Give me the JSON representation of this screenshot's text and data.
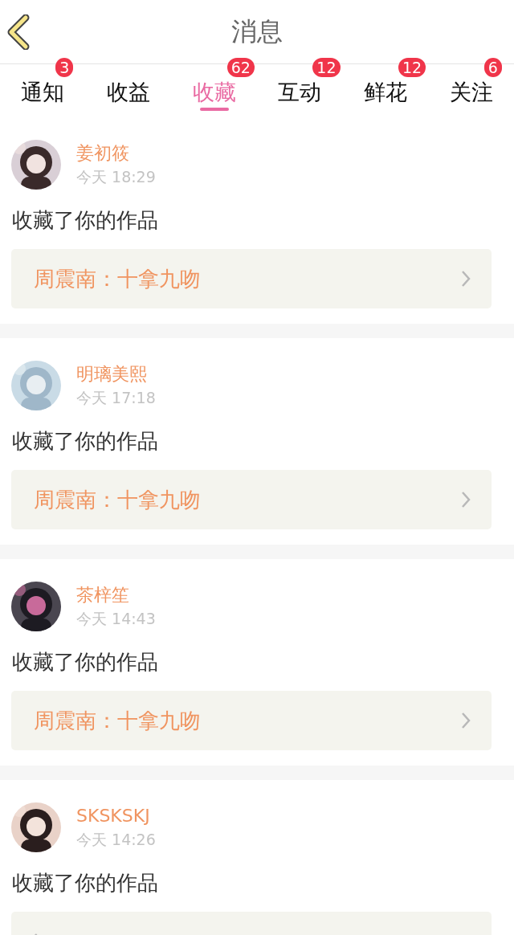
{
  "header": {
    "title": "消息"
  },
  "tabs": [
    {
      "label": "通知",
      "badge": "3",
      "selected": false
    },
    {
      "label": "收益",
      "selected": false
    },
    {
      "label": "收藏",
      "badge": "62",
      "selected": true
    },
    {
      "label": "互动",
      "badge": "12",
      "selected": false
    },
    {
      "label": "鲜花",
      "badge": "12",
      "selected": false
    },
    {
      "label": "关注",
      "badge": "6",
      "selected": false
    }
  ],
  "messages": [
    {
      "user": "姜初筱",
      "time": "今天 18:29",
      "action": "收藏了你的作品",
      "work": "周震南：十拿九吻"
    },
    {
      "user": "明璃美熙",
      "time": "今天 17:18",
      "action": "收藏了你的作品",
      "work": "周震南：十拿九吻"
    },
    {
      "user": "茶梓笙",
      "time": "今天 14:43",
      "action": "收藏了你的作品",
      "work": "周震南：十拿九吻"
    },
    {
      "user": "SKSKSKJ",
      "time": "今天 14:26",
      "action": "收藏了你的作品"
    }
  ]
}
